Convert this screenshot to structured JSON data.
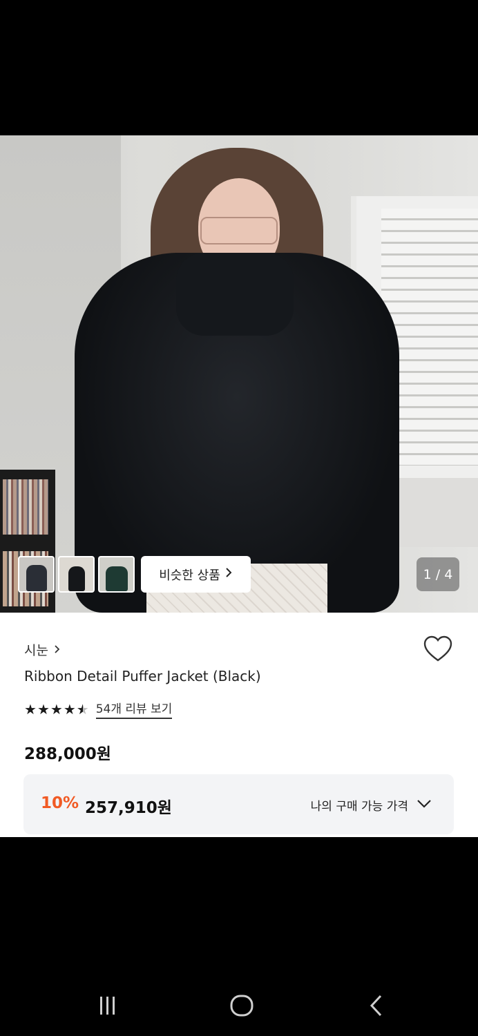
{
  "gallery": {
    "similar_label": "비슷한 상품",
    "counter": "1 / 4",
    "thumbnails": [
      "thumbnail-1",
      "thumbnail-2",
      "thumbnail-3"
    ]
  },
  "product": {
    "brand": "시눈",
    "title": "Ribbon Detail Puffer Jacket (Black)",
    "rating_stars": 4.5,
    "review_link": "54개 리뷰 보기",
    "price": "288,000원",
    "discount_percent": "10%",
    "discount_price": "257,910원",
    "my_price_label": "나의 구매 가능 가격"
  },
  "colors": {
    "accent": "#f15a24",
    "text": "#222222",
    "box": "#f3f4f6"
  },
  "icons": {
    "brand_arrow": "chevron-right-icon",
    "favorite": "heart-icon",
    "dropdown": "chevron-down-icon",
    "nav": [
      "recent-apps-icon",
      "home-icon",
      "back-icon"
    ]
  }
}
